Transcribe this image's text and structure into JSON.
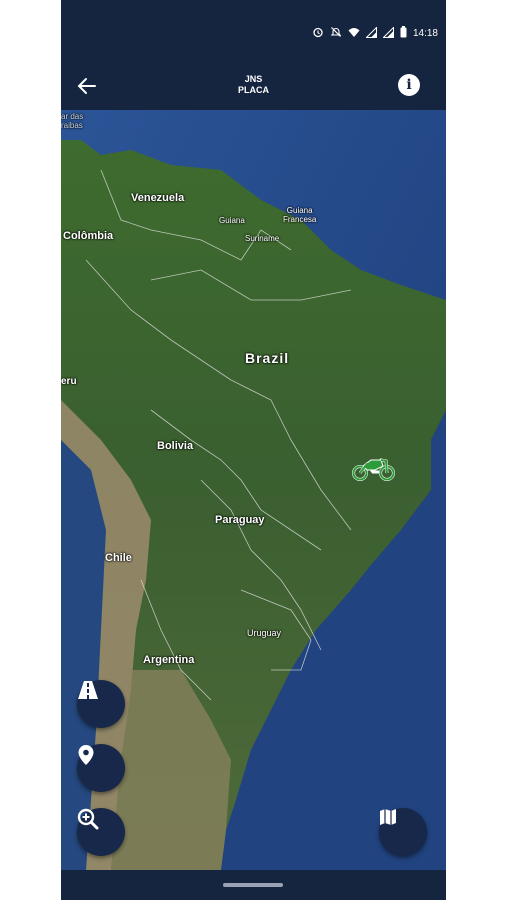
{
  "status_bar": {
    "time": "14:18",
    "icons": [
      "alarm-icon",
      "mute-icon",
      "wifi-icon",
      "signal-icon",
      "signal-icon",
      "battery-icon"
    ]
  },
  "app_bar": {
    "title": "JNS",
    "subtitle": "PLACA",
    "back_icon": "arrow-left-icon",
    "info_icon": "info-icon"
  },
  "map": {
    "labels": {
      "caribbean": "ar das\nraibas",
      "venezuela": "Venezuela",
      "colombia": "Colômbia",
      "guiana": "Guiana",
      "guiana_francesa": "Guiana\nFrancesa",
      "suriname": "Suriname",
      "brazil": "Brazil",
      "peru": "eru",
      "bolivia": "Bolivia",
      "paraguay": "Paraguay",
      "chile": "Chile",
      "uruguay": "Uruguay",
      "argentina": "Argentina"
    },
    "vehicle_marker": "motorcycle-icon",
    "marker_color": "#2e9b3a"
  },
  "fabs": {
    "route": "road-icon",
    "location": "map-pin-icon",
    "zoom": "zoom-in-icon",
    "map_type": "map-icon"
  }
}
